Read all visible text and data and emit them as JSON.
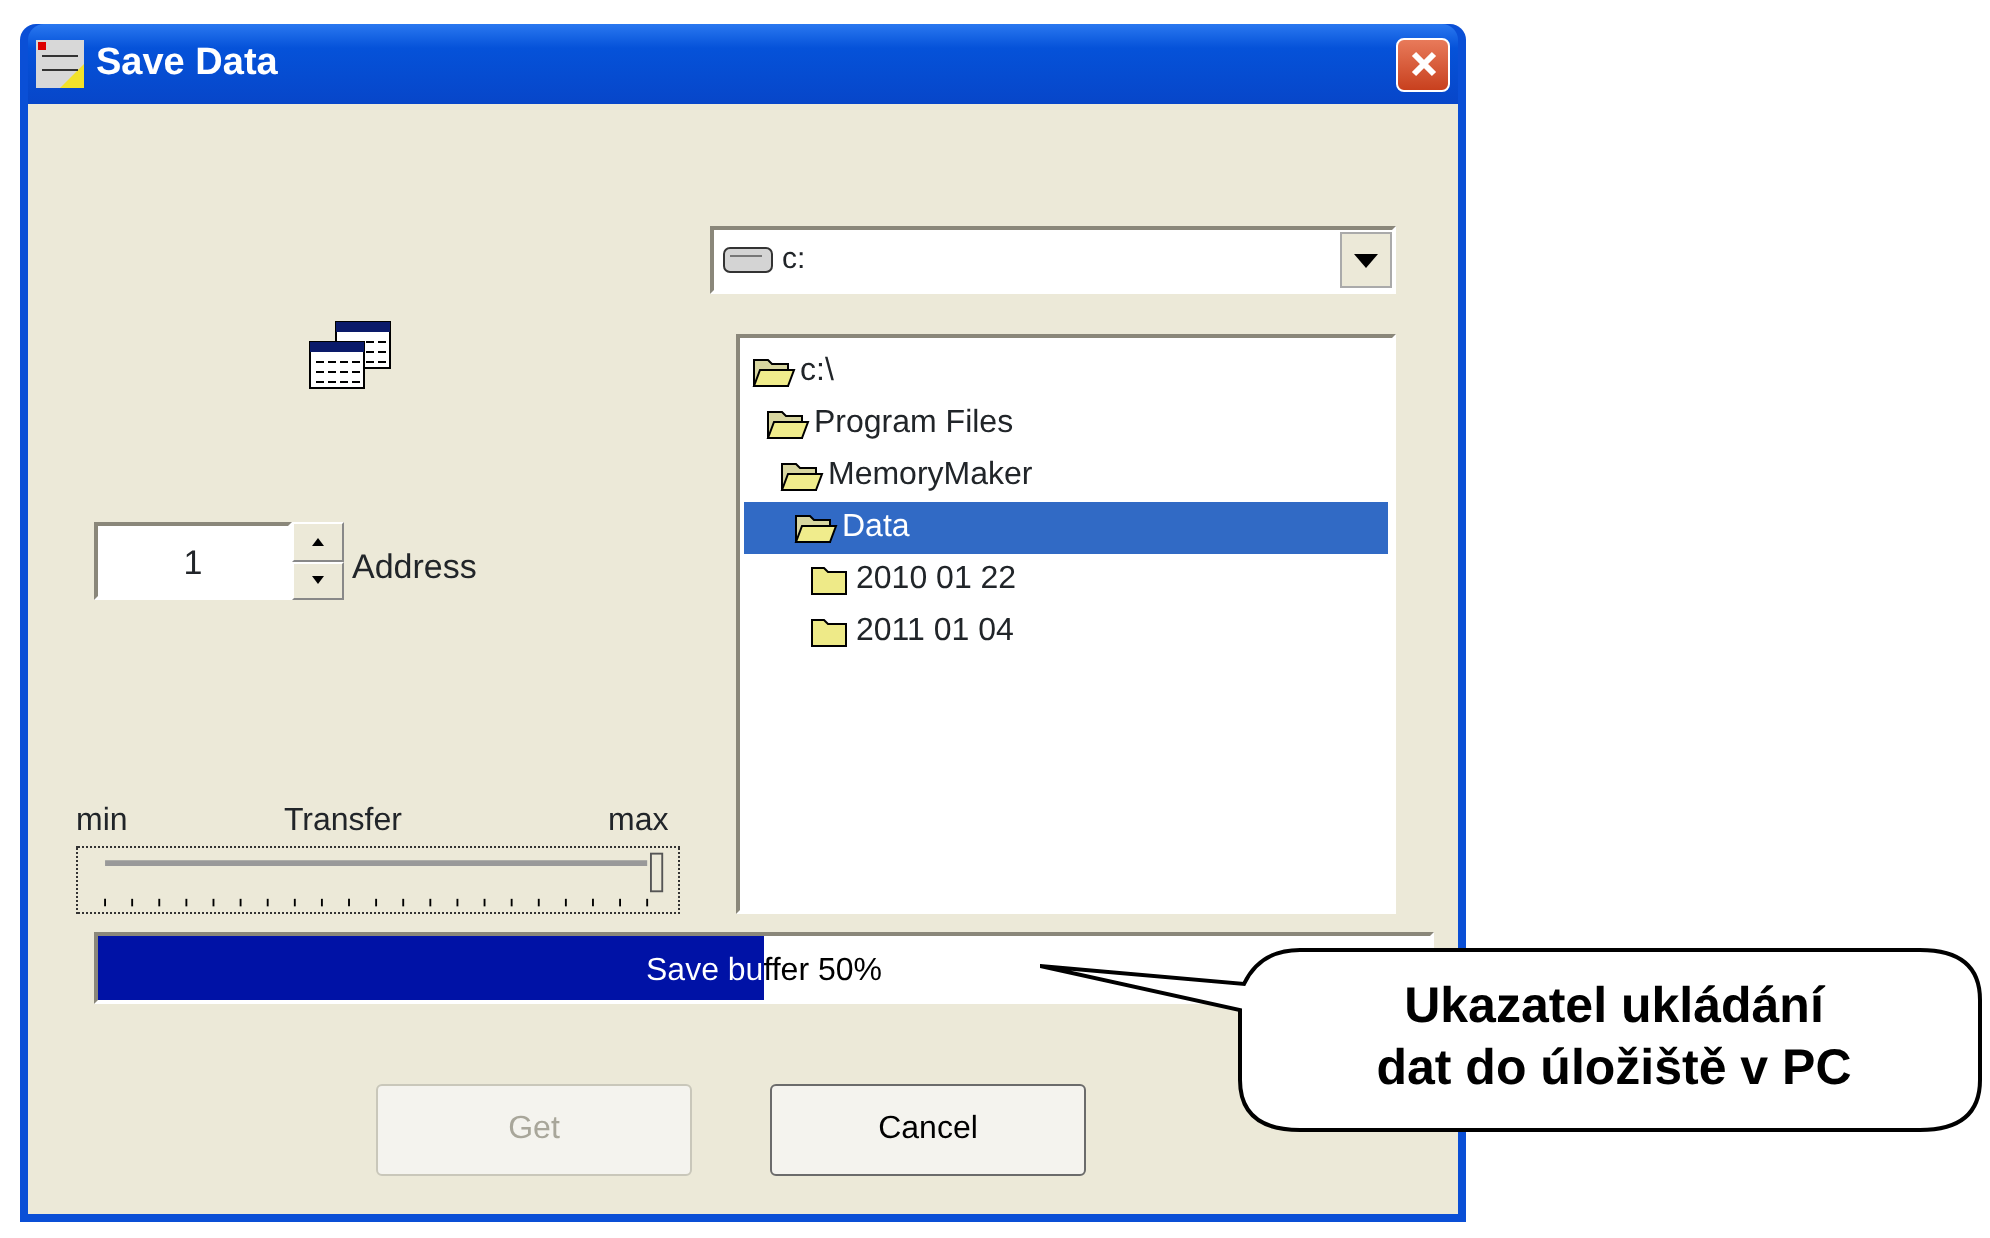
{
  "window": {
    "title": "Save Data"
  },
  "drive_combo": {
    "value": "c:"
  },
  "address": {
    "value": "1",
    "label": "Address"
  },
  "transfer": {
    "min_label": "min",
    "title": "Transfer",
    "max_label": "max",
    "level": 1
  },
  "tree": [
    {
      "label": "c:\\",
      "open": true,
      "selected": false,
      "children": [
        {
          "label": "Program Files",
          "open": true,
          "selected": false,
          "children": [
            {
              "label": "MemoryMaker",
              "open": true,
              "selected": false,
              "children": [
                {
                  "label": "Data",
                  "open": true,
                  "selected": true,
                  "children": [
                    {
                      "label": "2010 01 22",
                      "open": false,
                      "selected": false
                    },
                    {
                      "label": "2011 01 04",
                      "open": false,
                      "selected": false
                    }
                  ]
                }
              ]
            }
          ]
        }
      ]
    }
  ],
  "progress": {
    "label": "Save buffer 50%",
    "level": 0.5
  },
  "buttons": [
    {
      "label": "Get",
      "disabled": true
    },
    {
      "label": "Cancel",
      "disabled": false
    }
  ],
  "callout": {
    "lines": [
      "Ukazatel ukládání",
      "dat do úložiště v PC"
    ]
  }
}
